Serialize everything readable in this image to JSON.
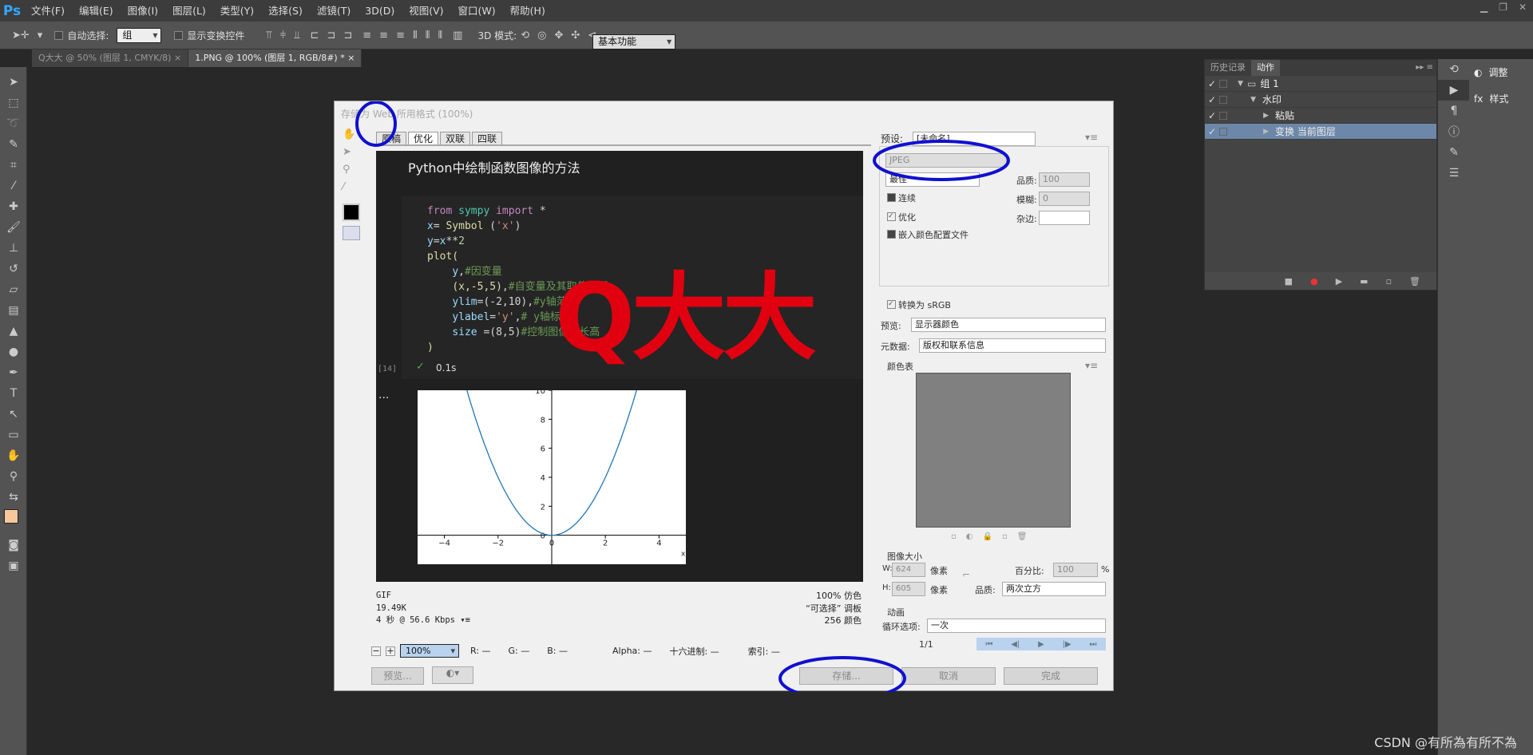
{
  "app": {
    "logo": "Ps"
  },
  "menu": [
    "文件(F)",
    "编辑(E)",
    "图像(I)",
    "图层(L)",
    "类型(Y)",
    "选择(S)",
    "滤镜(T)",
    "3D(D)",
    "视图(V)",
    "窗口(W)",
    "帮助(H)"
  ],
  "options_bar": {
    "auto_select_label": "自动选择:",
    "auto_select_value": "组",
    "show_transform_label": "显示变换控件",
    "mode_3d_label": "3D 模式:",
    "workspace": "基本功能"
  },
  "doc_tabs": [
    "Q大大 @ 50% (图层 1, CMYK/8)",
    "1.PNG @ 100% (图层 1, RGB/8#) *"
  ],
  "dialog": {
    "title": "存储为 Web 所用格式 (100%)",
    "view_tabs": [
      "原稿",
      "优化",
      "双联",
      "四联"
    ],
    "preview": {
      "heading": "Python中绘制函数图像的方法",
      "code": [
        {
          "indent": "",
          "parts": [
            [
              "from",
              "kw"
            ],
            [
              " sympy ",
              "mod"
            ],
            [
              "import",
              "kw"
            ],
            [
              " *",
              "op"
            ]
          ]
        },
        {
          "indent": "",
          "parts": [
            [
              "x",
              "var"
            ],
            [
              "= ",
              "op"
            ],
            [
              "Symbol",
              "fn"
            ],
            [
              " (",
              "op"
            ],
            [
              "'x'",
              "str"
            ],
            [
              ")",
              "op"
            ]
          ]
        },
        {
          "indent": "",
          "parts": [
            [
              "y",
              "var"
            ],
            [
              "=",
              "op"
            ],
            [
              "x",
              "var"
            ],
            [
              "**",
              "op"
            ],
            [
              "2",
              "num"
            ]
          ]
        },
        {
          "indent": "",
          "parts": [
            [
              "plot(",
              "fn"
            ]
          ]
        },
        {
          "indent": "    ",
          "parts": [
            [
              "y",
              "var"
            ],
            [
              ",",
              "op"
            ],
            [
              "#因变量",
              "cm"
            ]
          ]
        },
        {
          "indent": "    ",
          "parts": [
            [
              "(x,-5,5)",
              "arg"
            ],
            [
              ",",
              "op"
            ],
            [
              "#自变量及其取值范围",
              "cm"
            ]
          ]
        },
        {
          "indent": "    ",
          "parts": [
            [
              "ylim",
              "var"
            ],
            [
              "=(-2,10),",
              "op"
            ],
            [
              "#y轴范围",
              "cm"
            ]
          ]
        },
        {
          "indent": "    ",
          "parts": [
            [
              "ylabel",
              "var"
            ],
            [
              "=",
              "op"
            ],
            [
              "'y'",
              "str"
            ],
            [
              ",",
              "op"
            ],
            [
              "# y轴标",
              "cm"
            ]
          ]
        },
        {
          "indent": "    ",
          "parts": [
            [
              "size",
              "var"
            ],
            [
              " =(8,5)",
              "op"
            ],
            [
              "#控制图",
              "cm"
            ],
            [
              "像的长",
              "cm"
            ],
            [
              "高",
              "cm"
            ]
          ]
        },
        {
          "indent": "",
          "parts": [
            [
              ")",
              "fn"
            ]
          ]
        }
      ],
      "cell_number": "[14]",
      "exec_time": "0.1s",
      "ellipsis": "...",
      "watermark_text": "Q大大"
    },
    "chart_data": {
      "type": "line",
      "x_ticks": [
        "−4",
        "−2",
        "0",
        "2",
        "4"
      ],
      "y_ticks": [
        "0",
        "2",
        "4",
        "6",
        "8",
        "10"
      ],
      "xlim": [
        -5,
        5
      ],
      "ylim": [
        -2,
        10
      ],
      "x_axis_label": "x",
      "series": [
        {
          "function": "y = x**2",
          "color": "#1f77b4"
        }
      ]
    },
    "status_left": [
      "GIF",
      "19.49K",
      "4 秒 @ 56.6 Kbps"
    ],
    "status_right": [
      "100% 仿色",
      "“可选择” 调板",
      "256 颜色"
    ],
    "zoom": "100%",
    "readout": {
      "r": "R: —",
      "g": "G: —",
      "b": "B: —",
      "alpha": "Alpha: —",
      "hex": "十六进制: —",
      "index": "索引: —"
    },
    "buttons": {
      "preview": "预览...",
      "save": "存储...",
      "cancel": "取消",
      "done": "完成"
    },
    "settings": {
      "preset_label": "预设:",
      "preset_value": "[未命名]",
      "format": "JPEG",
      "quality_preset": "最佳",
      "quality_label": "品质:",
      "quality_value": "100",
      "progressive_label": "连续",
      "blur_label": "模糊:",
      "blur_value": "0",
      "optimized_label": "优化",
      "matte_label": "杂边:",
      "embed_profile_label": "嵌入颜色配置文件",
      "convert_srgb_label": "转换为 sRGB",
      "preview_label": "预览:",
      "preview_value": "显示器颜色",
      "metadata_label": "元数据:",
      "metadata_value": "版权和联系信息",
      "color_table_label": "颜色表",
      "image_size_label": "图像大小",
      "w_label": "W:",
      "w_value": "624",
      "h_label": "H:",
      "h_value": "605",
      "unit": "像素",
      "percent_label": "百分比:",
      "percent_value": "100",
      "percent_unit": "%",
      "quality2_label": "品质:",
      "quality2_value": "两次立方",
      "animation_label": "动画",
      "loop_label": "循环选项:",
      "loop_value": "一次",
      "frame_counter": "1/1"
    }
  },
  "panels": {
    "tabs": [
      "历史记录",
      "动作"
    ],
    "actions": [
      {
        "label": "组 1",
        "level": 0,
        "type": "folder"
      },
      {
        "label": "水印",
        "level": 1,
        "type": "action"
      },
      {
        "label": "粘贴",
        "level": 2,
        "type": "step"
      },
      {
        "label": "变换 当前图层",
        "level": 2,
        "type": "step",
        "selected": true
      }
    ],
    "side": [
      {
        "label": "调整"
      },
      {
        "label": "样式"
      }
    ]
  },
  "watermark": "CSDN @有所為有所不為"
}
